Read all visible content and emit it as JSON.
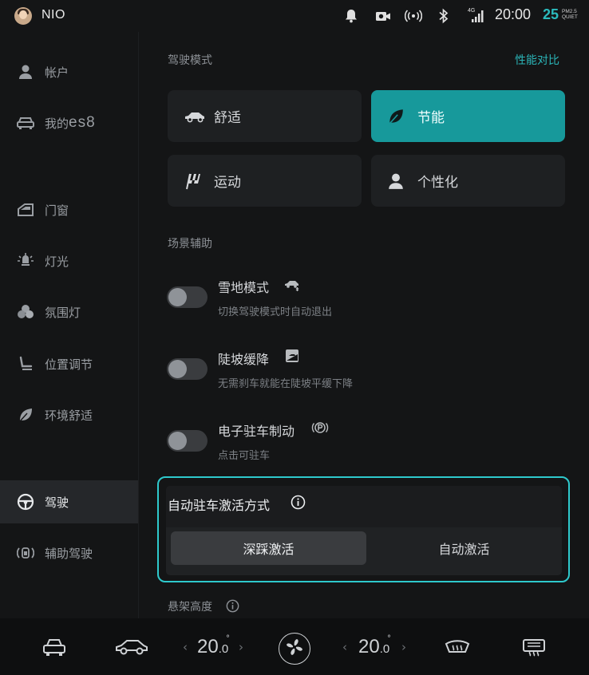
{
  "status_bar": {
    "brand": "NIO",
    "time": "20:00",
    "pm_value": "25",
    "pm_label_top": "PM2.5",
    "pm_label_bottom": "QUIET",
    "network": "4G",
    "icons": [
      "bell-icon",
      "dashcam-icon",
      "wireless-signal-icon",
      "bluetooth-icon",
      "cellular-signal-icon"
    ],
    "accent_color": "#2bbbbd"
  },
  "sidebar": {
    "items": [
      {
        "label": "帐户",
        "icon": "person-icon"
      },
      {
        "label": "我的",
        "suffix": "es8",
        "icon": "car-front-icon"
      },
      {
        "label": "门窗",
        "icon": "door-window-icon"
      },
      {
        "label": "灯光",
        "icon": "light-icon"
      },
      {
        "label": "氛围灯",
        "icon": "ambient-light-icon"
      },
      {
        "label": "位置调节",
        "icon": "seat-icon"
      },
      {
        "label": "环境舒适",
        "icon": "leaf-icon"
      },
      {
        "label": "驾驶",
        "icon": "steering-wheel-icon",
        "active": true
      },
      {
        "label": "辅助驾驶",
        "icon": "assisted-driving-icon"
      }
    ]
  },
  "main": {
    "drive_mode": {
      "title": "驾驶模式",
      "compare_link": "性能对比",
      "modes": [
        {
          "label": "舒适",
          "icon": "car-side-icon",
          "selected": false
        },
        {
          "label": "节能",
          "icon": "leaf-icon",
          "selected": true
        },
        {
          "label": "运动",
          "icon": "checkered-flag-icon",
          "selected": false
        },
        {
          "label": "个性化",
          "icon": "person-icon",
          "selected": false
        }
      ]
    },
    "scene_assist": {
      "title": "场景辅助",
      "toggles": [
        {
          "title": "雪地模式",
          "subtitle": "切换驾驶模式时自动退出",
          "icon": "snow-car-icon",
          "on": false
        },
        {
          "title": "陡坡缓降",
          "subtitle": "无需刹车就能在陡坡平缓下降",
          "icon": "hill-descent-icon",
          "on": false
        },
        {
          "title": "电子驻车制动",
          "subtitle": "点击可驻车",
          "icon": "parking-brake-icon",
          "on": false
        }
      ]
    },
    "auto_park": {
      "title": "自动驻车激活方式",
      "options": [
        "深踩激活",
        "自动激活"
      ],
      "selected": "深踩激活"
    },
    "suspension": {
      "title": "悬架高度"
    }
  },
  "bottom_bar": {
    "left_temp": {
      "int": "20",
      "dec": ".0",
      "unit": "°"
    },
    "right_temp": {
      "int": "20",
      "dec": ".0",
      "unit": "°"
    },
    "arrow_left": "‹",
    "arrow_right": "›",
    "icons": [
      "car-front-icon",
      "car-side-icon",
      "fan-icon",
      "front-defrost-icon",
      "rear-defrost-icon"
    ]
  }
}
